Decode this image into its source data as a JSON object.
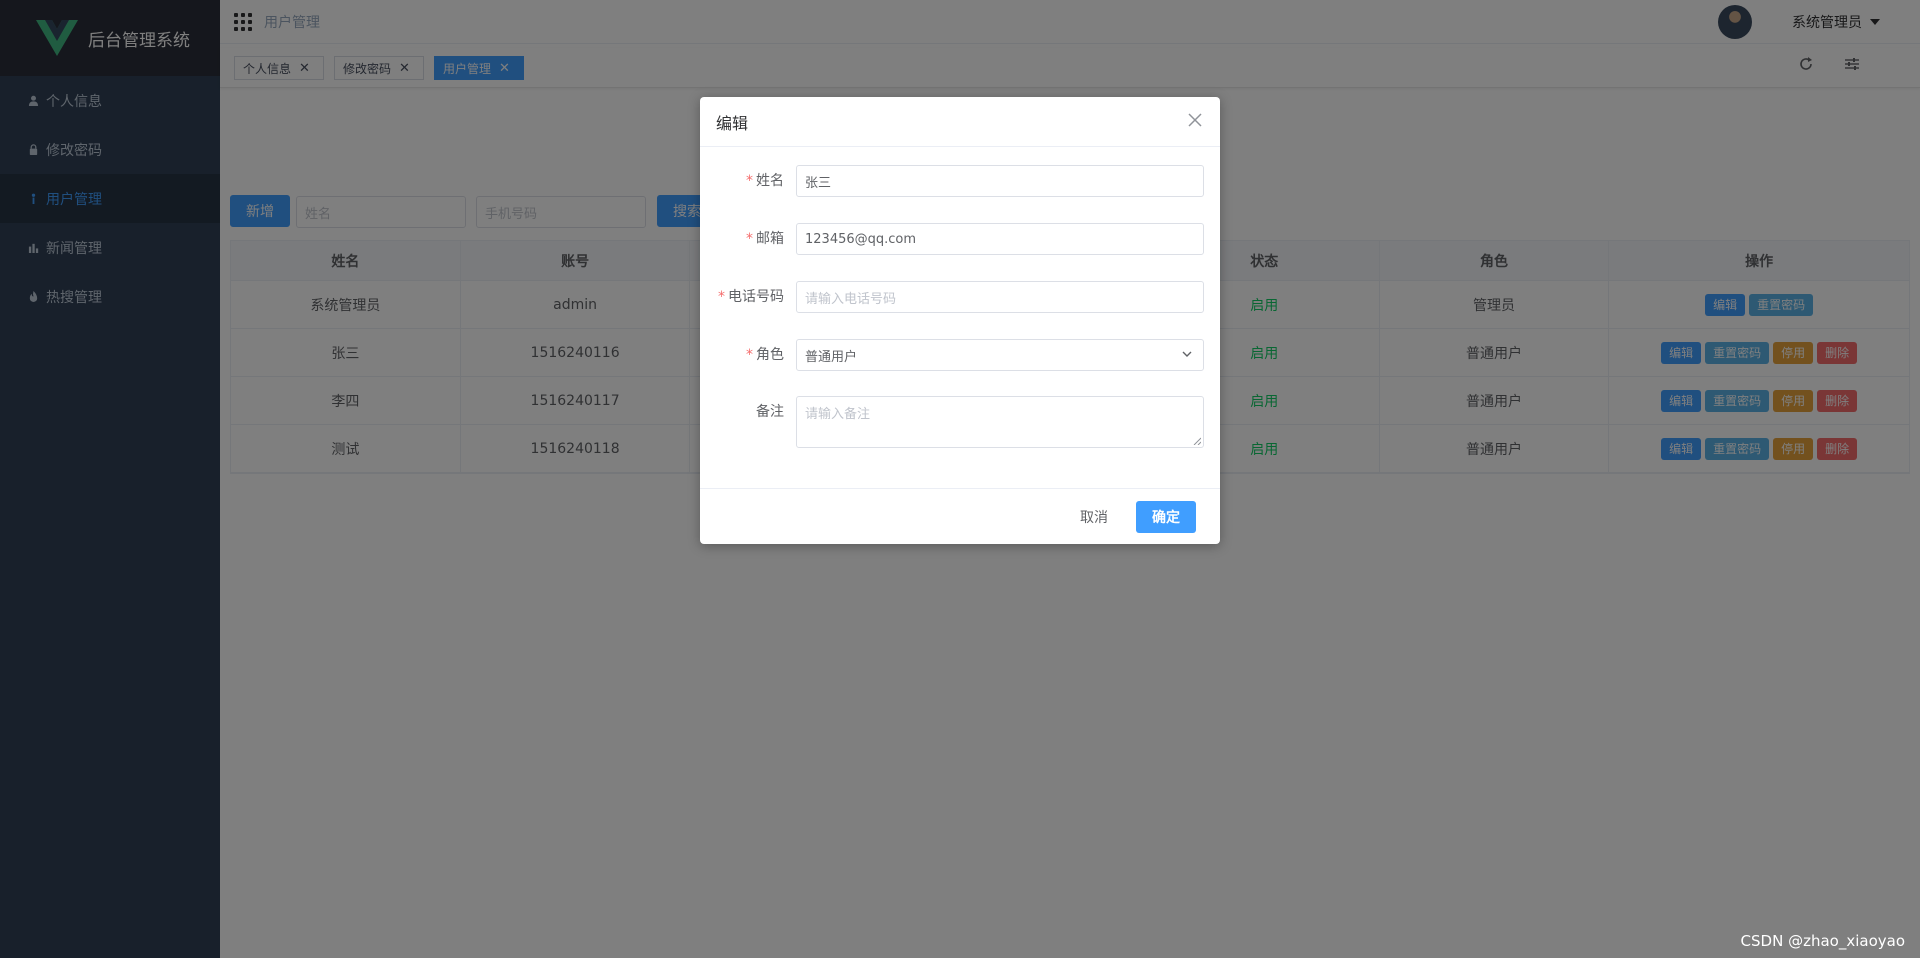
{
  "app": {
    "title": "后台管理系统"
  },
  "sidebar": {
    "items": [
      {
        "label": "个人信息",
        "icon": "user-icon",
        "active": false
      },
      {
        "label": "修改密码",
        "icon": "lock-icon",
        "active": false
      },
      {
        "label": "用户管理",
        "icon": "users-icon",
        "active": true
      },
      {
        "label": "新闻管理",
        "icon": "chart-icon",
        "active": false
      },
      {
        "label": "热搜管理",
        "icon": "fire-icon",
        "active": false
      }
    ]
  },
  "header": {
    "breadcrumb": "用户管理",
    "user_name": "系统管理员"
  },
  "tags": [
    {
      "label": "个人信息",
      "active": false
    },
    {
      "label": "修改密码",
      "active": false
    },
    {
      "label": "用户管理",
      "active": true
    }
  ],
  "toolbar": {
    "add_label": "新增",
    "name_placeholder": "姓名",
    "phone_placeholder": "手机号码",
    "search_label": "搜索"
  },
  "table": {
    "columns": [
      "姓名",
      "账号",
      "",
      "",
      "状态",
      "角色",
      "操作"
    ],
    "rows": [
      {
        "name": "系统管理员",
        "account": "admin",
        "status": "启用",
        "role": "管理员",
        "ops": [
          "编辑",
          "重置密码"
        ]
      },
      {
        "name": "张三",
        "account": "1516240116",
        "status": "启用",
        "role": "普通用户",
        "ops": [
          "编辑",
          "重置密码",
          "停用",
          "删除"
        ]
      },
      {
        "name": "李四",
        "account": "1516240117",
        "status": "启用",
        "role": "普通用户",
        "ops": [
          "编辑",
          "重置密码",
          "停用",
          "删除"
        ]
      },
      {
        "name": "测试",
        "account": "1516240118",
        "status": "启用",
        "role": "普通用户",
        "ops": [
          "编辑",
          "重置密码",
          "停用",
          "删除"
        ]
      }
    ]
  },
  "dialog": {
    "title": "编辑",
    "fields": {
      "name": {
        "label": "姓名",
        "value": "张三"
      },
      "email": {
        "label": "邮箱",
        "value": "123456@qq.com"
      },
      "phone": {
        "label": "电话号码",
        "placeholder": "请输入电话号码"
      },
      "role": {
        "label": "角色",
        "value": "普通用户"
      },
      "remark": {
        "label": "备注",
        "placeholder": "请输入备注"
      }
    },
    "cancel_label": "取消",
    "confirm_label": "确定"
  },
  "watermark": "CSDN @zhao_xiaoyao",
  "colors": {
    "primary": "#409eff",
    "sidebar_bg": "#304156",
    "success": "#13ce66",
    "warning": "#e6a23c",
    "danger": "#f56c6c",
    "info": "#5cb3e6"
  }
}
